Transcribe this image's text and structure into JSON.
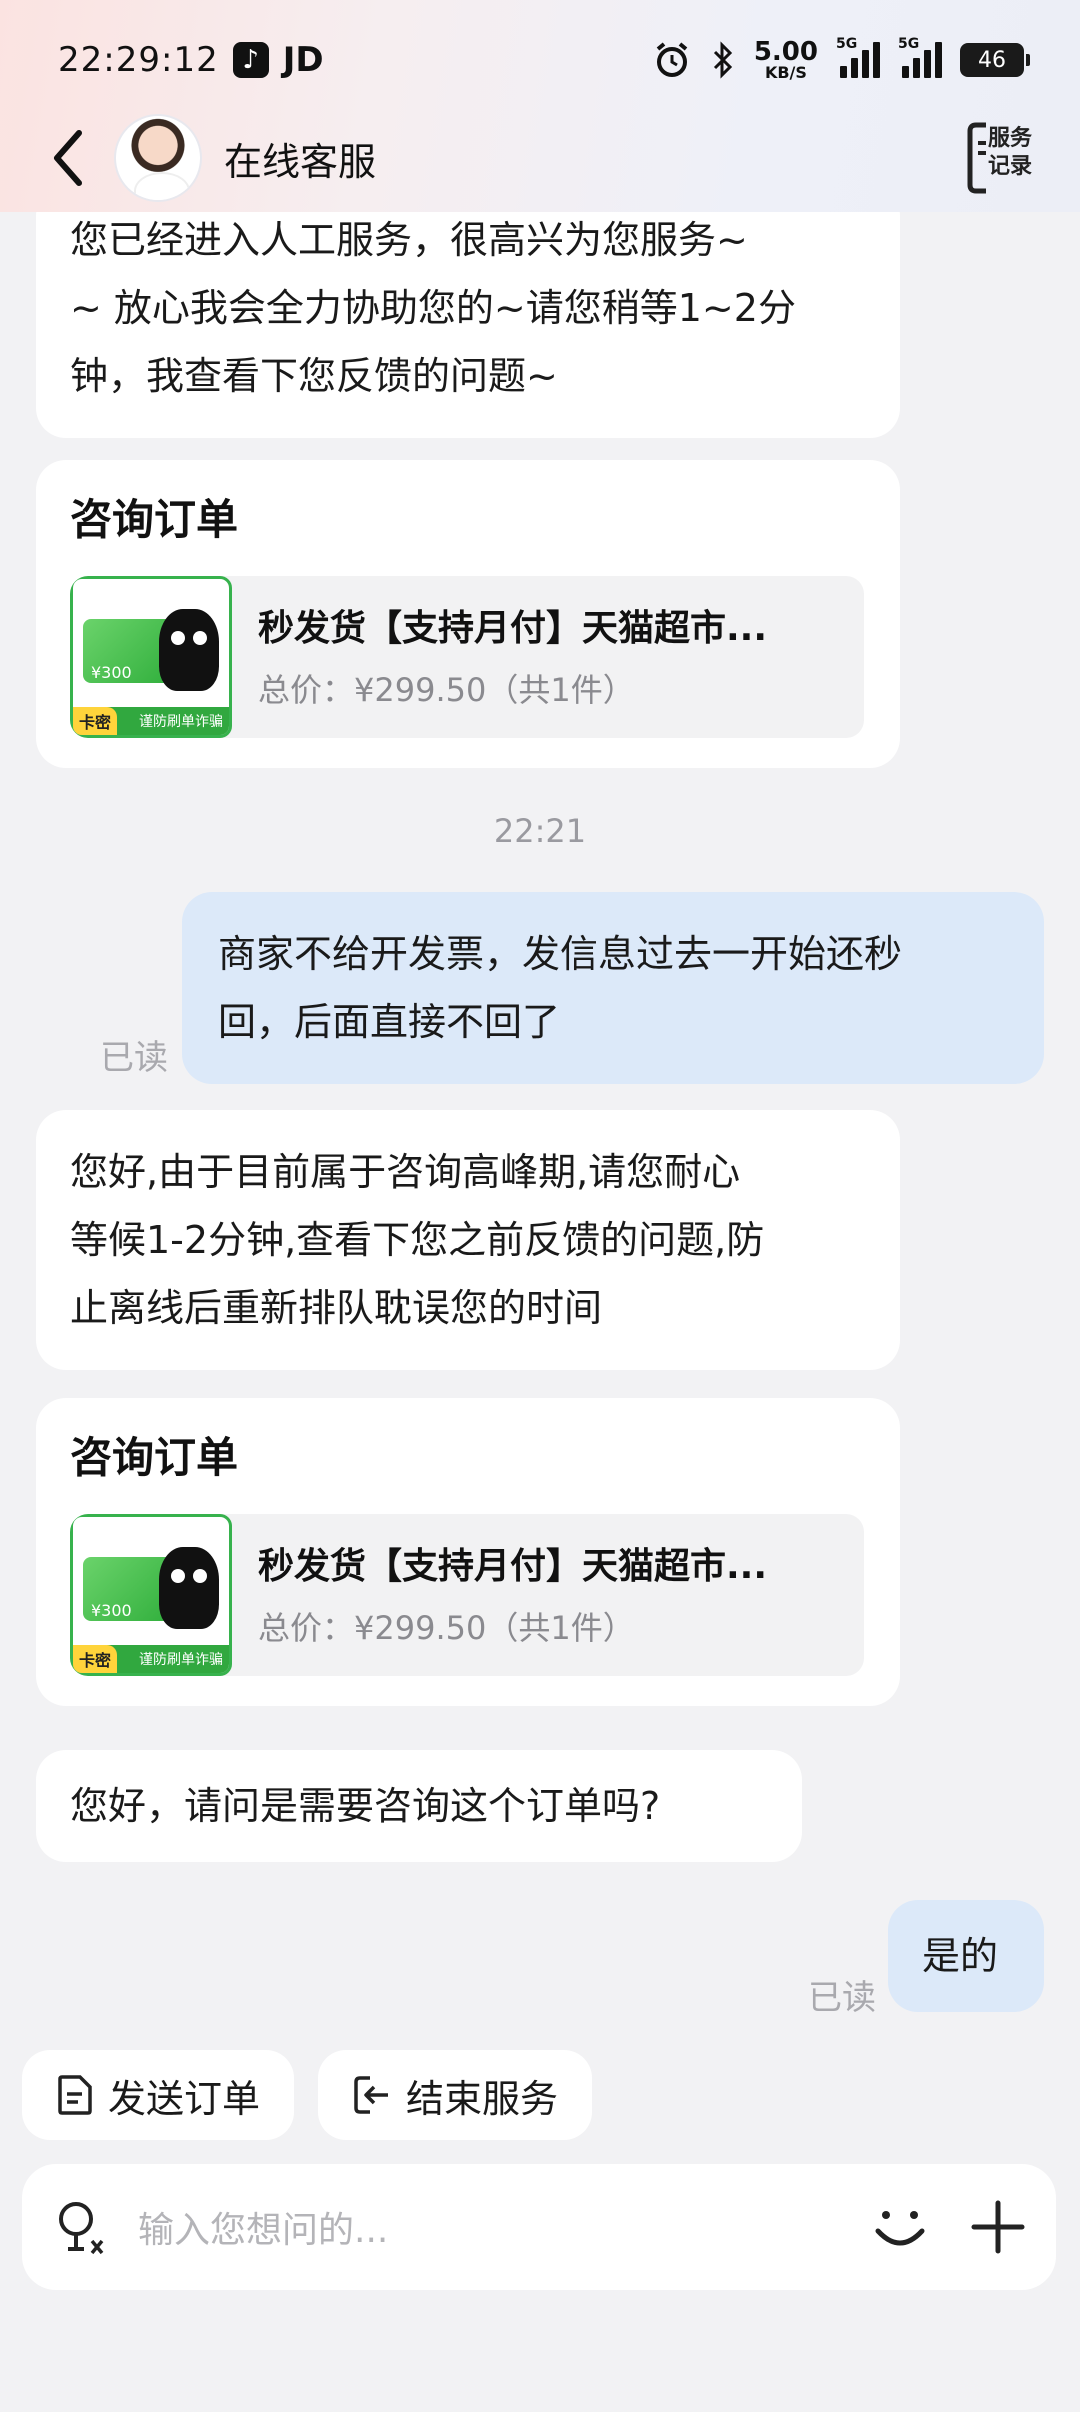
{
  "status_bar": {
    "time": "22:29:12",
    "app_label": "JD",
    "speed_value": "5.00",
    "speed_unit": "KB/S",
    "signal1_tag": "5G",
    "signal2_tag": "5G",
    "battery": "46"
  },
  "nav": {
    "title": "在线客服",
    "service_record_line1": "服务",
    "service_record_line2": "记录"
  },
  "messages": {
    "m1_line1": "您已经进入人工服务，很高兴为您服务~",
    "m1_line2": "~ 放心我会全力协助您的~请您稍等1~2分",
    "m1_line3": "钟，我查看下您反馈的问题~",
    "order1": {
      "heading": "咨询订单",
      "title": "秒发货【支持月付】天猫超市...",
      "price": "总价：¥299.50（共1件）",
      "thumb_value": "¥300",
      "thumb_badge": "卡密",
      "thumb_band": "谨防刷单诈骗"
    },
    "time": "22:21",
    "u1_line1": "商家不给开发票，发信息过去一开始还秒",
    "u1_line2": "回，后面直接不回了",
    "u1_read": "已读",
    "m2_line1": "您好,由于目前属于咨询高峰期,请您耐心",
    "m2_line2": "等候1-2分钟,查看下您之前反馈的问题,防",
    "m2_line3": "止离线后重新排队耽误您的时间",
    "order2": {
      "heading": "咨询订单",
      "title": "秒发货【支持月付】天猫超市...",
      "price": "总价：¥299.50（共1件）",
      "thumb_value": "¥300",
      "thumb_badge": "卡密",
      "thumb_band": "谨防刷单诈骗"
    },
    "m3": "您好，请问是需要咨询这个订单吗?",
    "u2": "是的",
    "u2_read": "已读"
  },
  "quick_actions": {
    "send_order": "发送订单",
    "end_service": "结束服务"
  },
  "input": {
    "placeholder": "输入您想问的..."
  }
}
